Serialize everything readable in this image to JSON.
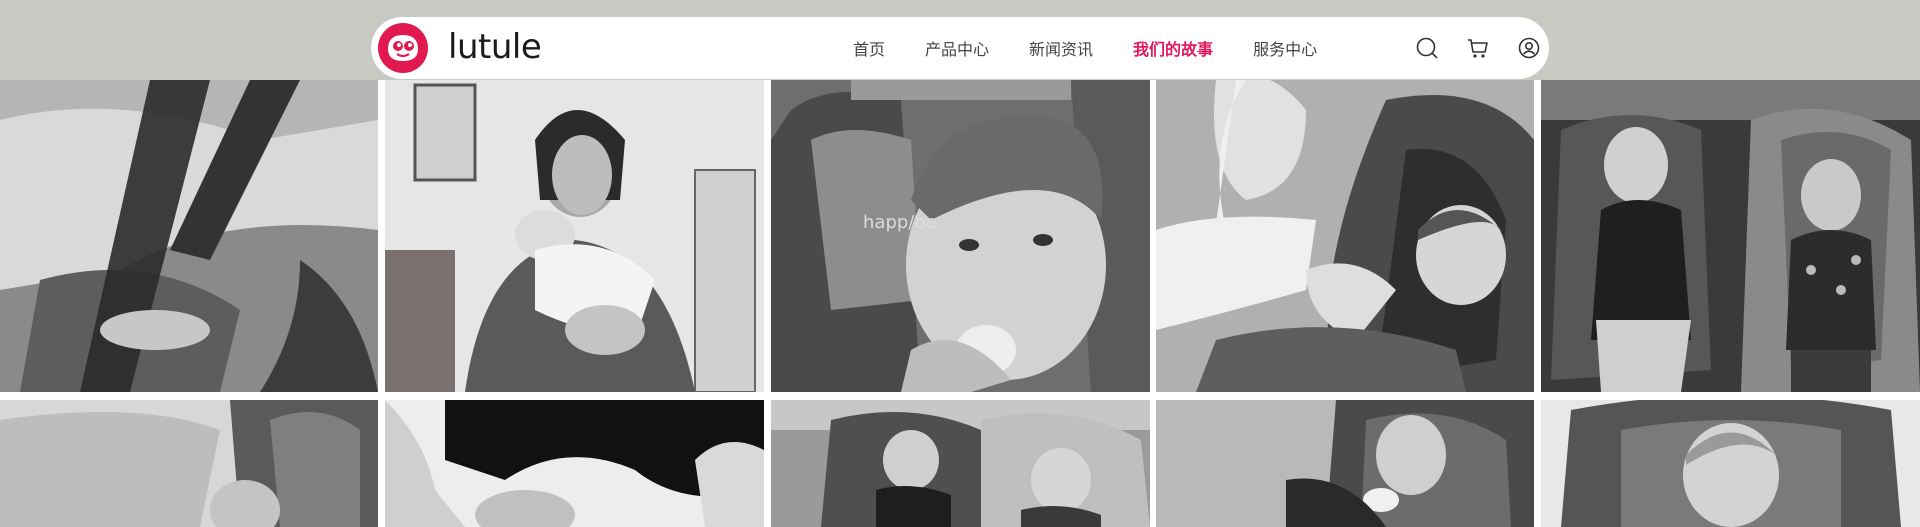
{
  "brand": {
    "name": "lutule",
    "accent_color": "#e0194f",
    "logo_icon": "brand-face-logo-icon"
  },
  "nav": {
    "items": [
      {
        "label": "首页",
        "active": false
      },
      {
        "label": "产品中心",
        "active": false
      },
      {
        "label": "新闻资讯",
        "active": false
      },
      {
        "label": "我们的故事",
        "active": true
      },
      {
        "label": "服务中心",
        "active": false
      }
    ],
    "active_color": "#e0195f",
    "icons": [
      "search-icon",
      "cart-icon",
      "user-icon"
    ]
  },
  "gallery": {
    "style": "grayscale",
    "photos": [
      {
        "subject": "child-seat-harness-closeup"
      },
      {
        "subject": "mother-holding-newborn"
      },
      {
        "subject": "toddler-in-car-seat-happybe",
        "seat_label": "happ/be"
      },
      {
        "subject": "mother-kissing-baby-foot"
      },
      {
        "subject": "two-boys-in-car-seats"
      },
      {
        "subject": "baby-in-car-seat-by-window"
      },
      {
        "subject": "holding-hands-outdoors"
      },
      {
        "subject": "boys-in-convertible"
      },
      {
        "subject": "baby-with-pacifier-in-seat"
      },
      {
        "subject": "smiling-boy-in-seat"
      }
    ]
  }
}
